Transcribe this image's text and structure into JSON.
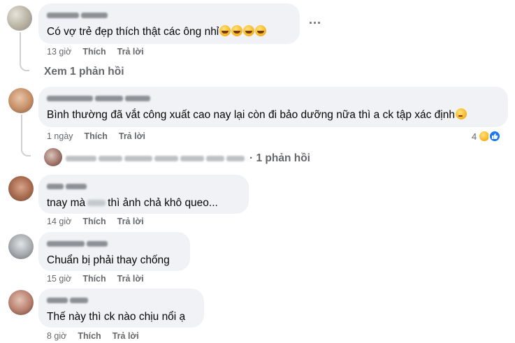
{
  "comments": [
    {
      "text": "Có vợ trẻ đẹp thích thật các ông nhỉ",
      "time": "13 giờ",
      "like": "Thích",
      "reply": "Trả lời"
    },
    {
      "text": "Bình thường đã vắt công xuất cao nay lại còn đi bảo dưỡng nữa thì a ck tập xác định",
      "time": "1 ngày",
      "like": "Thích",
      "reply": "Trả lời",
      "reaction_count": "4"
    },
    {
      "text_before": "tnay mà",
      "text_after": "thì ảnh chả khô queo...",
      "time": "14 giờ",
      "like": "Thích",
      "reply": "Trả lời"
    },
    {
      "text": "Chuẩn bị phải thay chống",
      "time": "15 giờ",
      "like": "Thích",
      "reply": "Trả lời"
    },
    {
      "text": "Thế này thì ck nào chịu nổi ạ",
      "time": "8 giờ",
      "like": "Thích",
      "reply": "Trả lời"
    }
  ],
  "view_replies": "Xem 1 phản hồi",
  "reply_summary": "· 1 phản hồi",
  "more_label": "...",
  "icons": {
    "more": "more-options-icon",
    "haha": "haha-reaction-icon",
    "like": "like-reaction-icon"
  },
  "colors": {
    "bubble": "#f0f2f5",
    "meta": "#65676b",
    "like_blue": "#1877f2"
  }
}
